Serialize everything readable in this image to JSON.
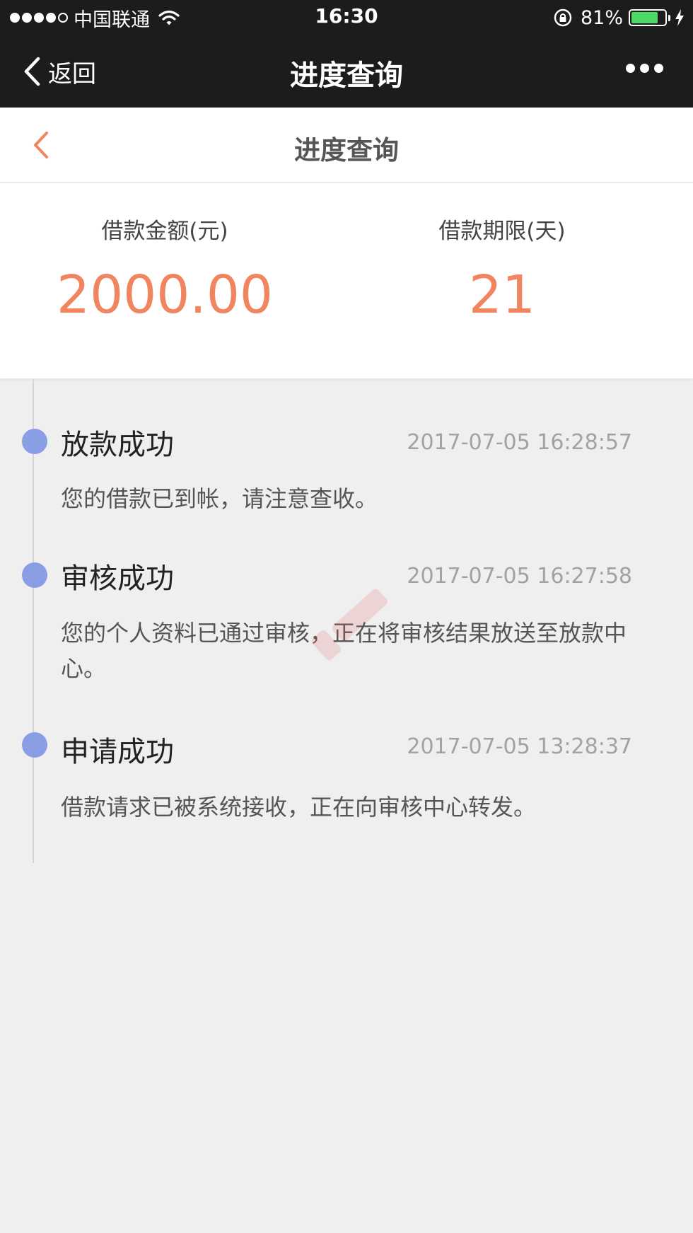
{
  "status_bar": {
    "carrier": "中国联通",
    "time": "16:30",
    "battery_percent": "81%",
    "battery_level": 0.81,
    "signal_filled": 4,
    "signal_total": 5
  },
  "nav_bar": {
    "back_label": "返回",
    "title": "进度查询",
    "more_icon": "more-dots-icon"
  },
  "page_header": {
    "title": "进度查询",
    "back_icon": "chevron-left-icon"
  },
  "summary": {
    "amount_label": "借款金额(元)",
    "amount_value": "2000.00",
    "term_label": "借款期限(天)",
    "term_value": "21"
  },
  "timeline": [
    {
      "title": "放款成功",
      "time": "2017-07-05  16:28:57",
      "description": "您的借款已到帐，请注意查收。"
    },
    {
      "title": "审核成功",
      "time": "2017-07-05  16:27:58",
      "description": "您的个人资料已通过审核，正在将审核结果放送至放款中心。"
    },
    {
      "title": "申请成功",
      "time": "2017-07-05  13:28:37",
      "description": "借款请求已被系统接收，正在向审核中心转发。"
    }
  ],
  "colors": {
    "accent": "#f0855f",
    "timeline_dot": "#8a9ee5",
    "nav_background": "#1c1c1e",
    "page_background": "#efeff0"
  }
}
